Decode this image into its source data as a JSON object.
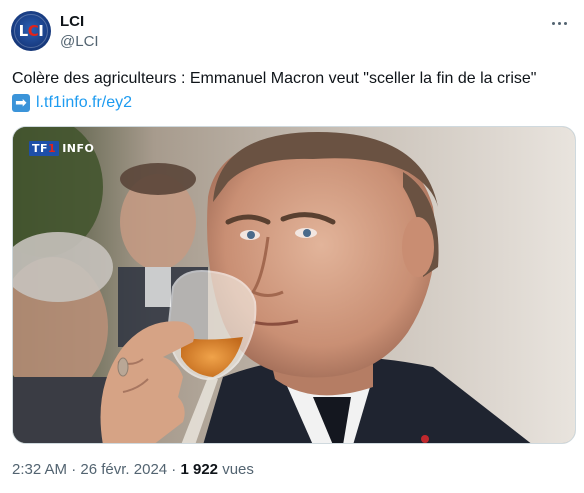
{
  "author": {
    "display_name": "LCI",
    "handle": "@LCI",
    "avatar_text_left": "L",
    "avatar_text_mid": "C",
    "avatar_text_right": "I"
  },
  "tweet": {
    "text": "Colère des agriculteurs : Emmanuel Macron veut \"sceller la fin de la crise\"",
    "arrow_emoji": "➡",
    "link_text": "l.tf1info.fr/ey2"
  },
  "media": {
    "watermark_tf": "TF",
    "watermark_one": "1",
    "watermark_info": "INFO"
  },
  "meta": {
    "time": "2:32 AM",
    "separator1": "·",
    "date": "26 févr. 2024",
    "separator2": "·",
    "views_count": "1 922",
    "views_label": "vues"
  },
  "colors": {
    "link": "#1d9bf0",
    "secondary_text": "#536471",
    "primary_text": "#0f1419",
    "brand_blue": "#1a3f86",
    "brand_red": "#e2231a"
  },
  "icons": {
    "more": "more-horizontal-icon",
    "arrow": "right-arrow-emoji-icon"
  }
}
